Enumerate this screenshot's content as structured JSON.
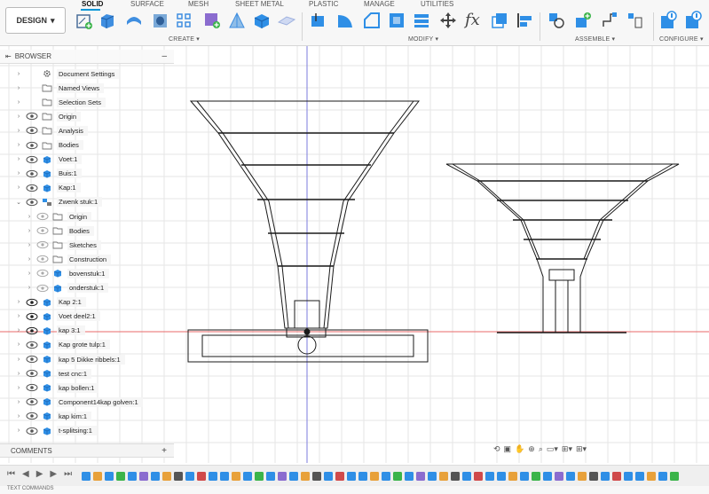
{
  "toolbar": {
    "design_label": "DESIGN",
    "tabs": [
      "SOLID",
      "SURFACE",
      "MESH",
      "SHEET METAL",
      "PLASTIC",
      "MANAGE",
      "UTILITIES"
    ],
    "active_tab": "SOLID",
    "groups": {
      "create": "CREATE",
      "modify": "MODIFY",
      "assemble": "ASSEMBLE",
      "configure": "CONFIGURE"
    },
    "accent": "#0696d7"
  },
  "browser": {
    "title": "BROWSER",
    "items": [
      {
        "label": "Document Settings",
        "icon": "gear-icon",
        "indent": 0,
        "eye": false,
        "expanded": false
      },
      {
        "label": "Named Views",
        "icon": "folder-icon",
        "indent": 0,
        "eye": false,
        "expanded": false
      },
      {
        "label": "Selection Sets",
        "icon": "folder-icon",
        "indent": 0,
        "eye": false,
        "expanded": false
      },
      {
        "label": "Origin",
        "icon": "folder-icon",
        "indent": 0,
        "eye": true,
        "expanded": false
      },
      {
        "label": "Analysis",
        "icon": "folder-icon",
        "indent": 0,
        "eye": true,
        "expanded": false
      },
      {
        "label": "Bodies",
        "icon": "folder-icon",
        "indent": 0,
        "eye": true,
        "expanded": false
      },
      {
        "label": "Voet:1",
        "icon": "component-icon",
        "indent": 0,
        "eye": true,
        "expanded": false
      },
      {
        "label": "Buis:1",
        "icon": "component-icon",
        "indent": 0,
        "eye": true,
        "expanded": false
      },
      {
        "label": "Kap:1",
        "icon": "component-icon",
        "indent": 0,
        "eye": true,
        "expanded": false
      },
      {
        "label": "Zwenk stuk:1",
        "icon": "assembly-icon",
        "indent": 0,
        "eye": true,
        "expanded": true
      },
      {
        "label": "Origin",
        "icon": "folder-icon",
        "indent": 1,
        "eye": true,
        "expanded": false
      },
      {
        "label": "Bodies",
        "icon": "folder-icon",
        "indent": 1,
        "eye": true,
        "expanded": false
      },
      {
        "label": "Sketches",
        "icon": "folder-icon",
        "indent": 1,
        "eye": true,
        "expanded": false
      },
      {
        "label": "Construction",
        "icon": "folder-icon",
        "indent": 1,
        "eye": true,
        "expanded": false
      },
      {
        "label": "bovenstuk:1",
        "icon": "component-icon",
        "indent": 1,
        "eye": true,
        "expanded": false
      },
      {
        "label": "onderstuk:1",
        "icon": "component-icon",
        "indent": 1,
        "eye": true,
        "expanded": false
      },
      {
        "label": "Kap 2:1",
        "icon": "component-icon",
        "indent": 0,
        "eye": true,
        "expanded": false
      },
      {
        "label": "Voet deel2:1",
        "icon": "component-icon",
        "indent": 0,
        "eye": true,
        "expanded": false
      },
      {
        "label": "kap 3:1",
        "icon": "component-icon",
        "indent": 0,
        "eye": true,
        "expanded": false
      },
      {
        "label": "Kap grote tulp:1",
        "icon": "component-icon",
        "indent": 0,
        "eye": true,
        "expanded": false
      },
      {
        "label": "kap 5 Dikke ribbels:1",
        "icon": "component-icon",
        "indent": 0,
        "eye": true,
        "expanded": false
      },
      {
        "label": "test cnc:1",
        "icon": "component-icon",
        "indent": 0,
        "eye": true,
        "expanded": false
      },
      {
        "label": "kap bollen:1",
        "icon": "component-icon",
        "indent": 0,
        "eye": true,
        "expanded": false
      },
      {
        "label": "Component14kap golven:1",
        "icon": "component-icon",
        "indent": 0,
        "eye": true,
        "expanded": false
      },
      {
        "label": "kap kim:1",
        "icon": "component-icon",
        "indent": 0,
        "eye": true,
        "expanded": false
      },
      {
        "label": "t-splitsing:1",
        "icon": "component-icon",
        "indent": 0,
        "eye": true,
        "expanded": false
      }
    ]
  },
  "comments": {
    "title": "COMMENTS"
  },
  "bottom": {
    "text_commands": "TEXT COMMANDS"
  },
  "colors": {
    "component_blue": "#2f8fe6",
    "axis_red": "#e86a6a",
    "axis_blue": "#7b7bdc",
    "grid": "#e6e6e6"
  }
}
